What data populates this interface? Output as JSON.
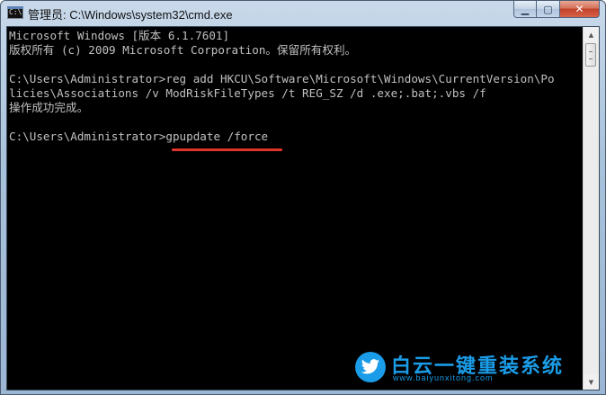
{
  "window": {
    "title": "管理员: C:\\Windows\\system32\\cmd.exe",
    "icon_text": "C:\\",
    "controls": {
      "minimize_glyph": "▁",
      "maximize_glyph": "▢",
      "close_glyph": "✕"
    }
  },
  "console": {
    "lines": [
      "Microsoft Windows [版本 6.1.7601]",
      "版权所有 (c) 2009 Microsoft Corporation。保留所有权利。",
      "",
      "C:\\Users\\Administrator>reg add HKCU\\Software\\Microsoft\\Windows\\CurrentVersion\\Po",
      "licies\\Associations /v ModRiskFileTypes /t REG_SZ /d .exe;.bat;.vbs /f",
      "操作成功完成。",
      "",
      "C:\\Users\\Administrator>gpupdate /force"
    ],
    "prompt": "C:\\Users\\Administrator>",
    "current_command": "gpupdate /force",
    "text_color": "#c0c0c0",
    "background": "#000000",
    "highlight_color": "#e0332a"
  },
  "watermark": {
    "title": "白云一键重装系统",
    "url": "www.baiyunxitong.com",
    "icon": "twitter-bird-icon",
    "color": "#1b9ce8"
  }
}
